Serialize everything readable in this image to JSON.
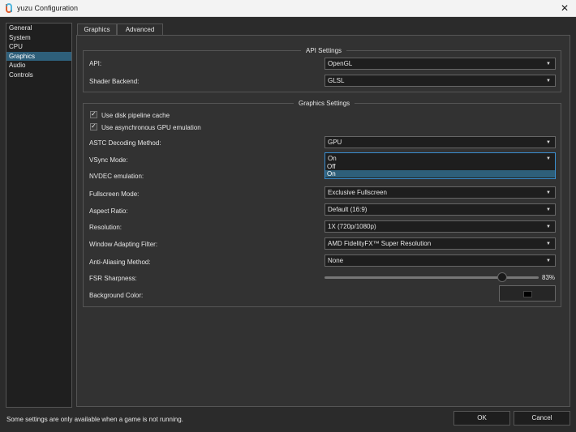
{
  "window": {
    "title": "yuzu Configuration"
  },
  "sidebar": {
    "items": [
      {
        "label": "General",
        "active": false
      },
      {
        "label": "System",
        "active": false
      },
      {
        "label": "CPU",
        "active": false
      },
      {
        "label": "Graphics",
        "active": true
      },
      {
        "label": "Audio",
        "active": false
      },
      {
        "label": "Controls",
        "active": false
      }
    ]
  },
  "tabs": [
    {
      "label": "Graphics"
    },
    {
      "label": "Advanced"
    }
  ],
  "api_settings": {
    "legend": "API Settings",
    "api": {
      "label": "API:",
      "value": "OpenGL"
    },
    "shader_backend": {
      "label": "Shader Backend:",
      "value": "GLSL"
    }
  },
  "graphics_settings": {
    "legend": "Graphics Settings",
    "disk_pipeline_cache": {
      "label": "Use disk pipeline cache",
      "checked": true
    },
    "async_gpu": {
      "label": "Use asynchronous GPU emulation",
      "checked": true
    },
    "astc": {
      "label": "ASTC Decoding Method:",
      "value": "GPU"
    },
    "vsync": {
      "label": "VSync Mode:",
      "value": "On",
      "options": [
        "Off",
        "On"
      ]
    },
    "nvdec": {
      "label": "NVDEC emulation:"
    },
    "fullscreen": {
      "label": "Fullscreen Mode:",
      "value": "Exclusive Fullscreen"
    },
    "aspect": {
      "label": "Aspect Ratio:",
      "value": "Default (16:9)"
    },
    "resolution": {
      "label": "Resolution:",
      "value": "1X (720p/1080p)"
    },
    "filter": {
      "label": "Window Adapting Filter:",
      "value": "AMD FidelityFX™ Super Resolution"
    },
    "aa": {
      "label": "Anti-Aliasing Method:",
      "value": "None"
    },
    "fsr": {
      "label": "FSR Sharpness:",
      "value": "83%",
      "level": 0.83
    },
    "bg": {
      "label": "Background Color:",
      "color": "#000000"
    }
  },
  "footer": {
    "status": "Some settings are only available when a game is not running.",
    "ok": "OK",
    "cancel": "Cancel"
  }
}
